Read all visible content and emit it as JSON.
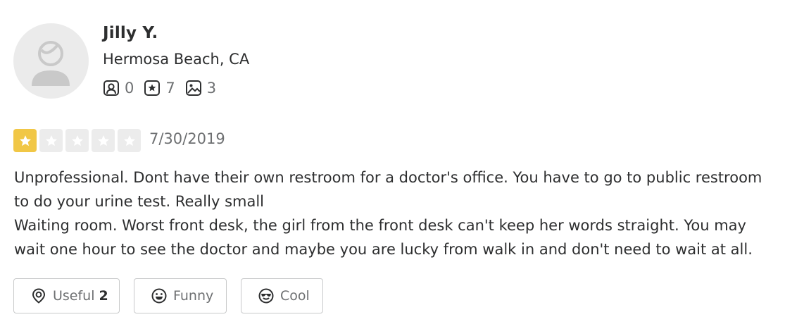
{
  "user": {
    "name": "Jilly Y.",
    "location": "Hermosa Beach, CA",
    "stats": {
      "friends": "0",
      "reviews": "7",
      "photos": "3"
    }
  },
  "review": {
    "rating": 1,
    "max_rating": 5,
    "date": "7/30/2019",
    "paragraphs": [
      "Unprofessional. Dont have their own restroom for a doctor's office. You have to go to public restroom to do your urine test. Really small",
      "Waiting room. Worst front desk, the girl from the front desk can't keep her words straight. You may wait one hour to see the doctor and maybe you are lucky from walk in and don't need to wait at all."
    ]
  },
  "reactions": {
    "useful_label": "Useful",
    "useful_count": "2",
    "funny_label": "Funny",
    "cool_label": "Cool"
  },
  "colors": {
    "star_active": "#f1c746",
    "star_inactive": "#ececec",
    "text_primary": "#2d2e2f",
    "text_secondary": "#6e7072"
  },
  "icons": [
    "default-avatar-icon",
    "friends-icon",
    "reviews-star-icon",
    "photos-icon",
    "star-icon",
    "useful-icon",
    "funny-icon",
    "cool-icon"
  ]
}
